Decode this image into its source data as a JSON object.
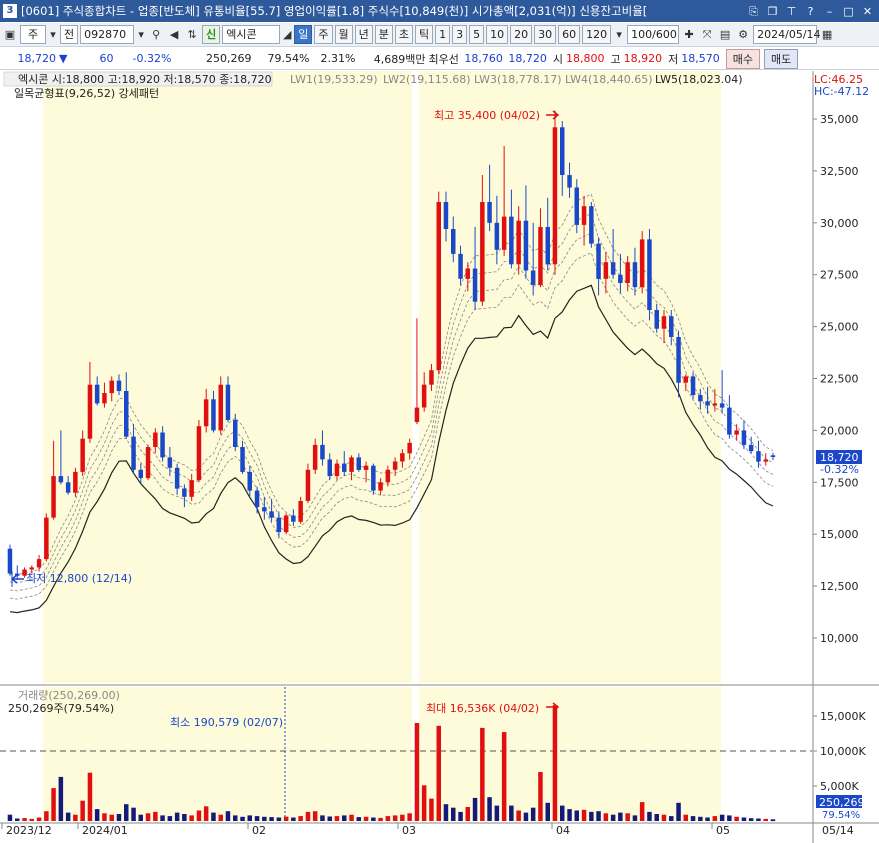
{
  "titlebar": {
    "screen_no": "3",
    "title": "[0601] 주식종합차트 - 업종[반도체] 유통비율[55.7] 영업이익률[1.8] 주식수[10,849(천)] 시가총액[2,031(억)] 신용잔고비율["
  },
  "toolbar": {
    "market": "주",
    "all_label": "전",
    "code": "092870",
    "credit_badge": "신",
    "stock_name": "엑시콘",
    "periods": [
      "일",
      "주",
      "월",
      "년",
      "분",
      "초",
      "틱"
    ],
    "intervals": [
      "1",
      "3",
      "5",
      "10",
      "20",
      "30",
      "60",
      "120"
    ],
    "count": "100/600",
    "date": "2024/05/14"
  },
  "quote": {
    "price": "18,720",
    "change": "60",
    "change_pct": "-0.32%",
    "volume": "250,269",
    "vol_ratio": "79.54%",
    "turnover": "2.31%",
    "amount": "4,689백만",
    "best_ask_label": "최우선",
    "best_ask": "18,760",
    "best_bid": "18,720",
    "open_label": "시",
    "open": "18,800",
    "high_label": "고",
    "high": "18,920",
    "low_label": "저",
    "low": "18,570",
    "buy_label": "매수",
    "sell_label": "매도"
  },
  "price_panel": {
    "legend_main": "엑시콘 시:18,800 고:18,920 저:18,570 종:18,720",
    "lw": [
      "LW1(19,533.29)",
      "LW2(19,115.68)",
      "LW3(18,778.17)",
      "LW4(18,440.65)",
      "LW5(18,023.04)"
    ],
    "sub_legend": "일목균형표(9,26,52) 강세패턴",
    "lc": "LC:46.25",
    "hc": "HC:-47.12",
    "max_label": "최고 35,400 (04/02)",
    "min_label": "최저 12,800 (12/14)",
    "price_tag": "18,720",
    "pct_tag": "-0.32%",
    "y_ticks": [
      "35,000",
      "32,500",
      "30,000",
      "27,500",
      "25,000",
      "22,500",
      "20,000",
      "17,500",
      "15,000",
      "12,500",
      "10,000"
    ]
  },
  "volume_panel": {
    "title": "거래량(250,269.00)",
    "sub": "250,269주(79.54%)",
    "min_label": "최소 190,579 (02/07)",
    "max_label": "최대 16,536K (04/02)",
    "y_ticks": [
      "15,000K",
      "10,000K",
      "5,000K"
    ],
    "vol_tag": "250,269",
    "pct_tag": "79.54%"
  },
  "x_axis": {
    "labels": [
      "2023/12",
      "2024/01",
      "02",
      "03",
      "04",
      "05"
    ],
    "right_label": "05/14"
  },
  "colors": {
    "up": "#e01010",
    "down": "#1a48c8",
    "highlight": "#fdfbd9",
    "titlebar": "#2e5a9c"
  },
  "candles": [
    [
      14300,
      14500,
      13000,
      13100
    ],
    [
      13100,
      13500,
      12800,
      13000
    ],
    [
      13000,
      13400,
      12900,
      13300
    ],
    [
      13300,
      13500,
      13100,
      13400
    ],
    [
      13400,
      14000,
      13200,
      13800
    ],
    [
      13800,
      16000,
      13700,
      15800
    ],
    [
      15800,
      19500,
      15700,
      17800
    ],
    [
      17800,
      20000,
      17400,
      17500
    ],
    [
      17500,
      17800,
      16900,
      17000
    ],
    [
      17000,
      18200,
      16800,
      18000
    ],
    [
      18000,
      20000,
      17800,
      19600
    ],
    [
      19600,
      23300,
      19400,
      22200
    ],
    [
      22200,
      22600,
      21200,
      21300
    ],
    [
      21300,
      22300,
      21100,
      21800
    ],
    [
      21800,
      22600,
      21400,
      22400
    ],
    [
      22400,
      22700,
      21700,
      21900
    ],
    [
      21900,
      22800,
      19600,
      19700
    ],
    [
      19700,
      20300,
      17900,
      18100
    ],
    [
      18100,
      18400,
      17400,
      17700
    ],
    [
      17700,
      19300,
      17600,
      19200
    ],
    [
      19200,
      20100,
      18900,
      19900
    ],
    [
      19900,
      20200,
      18500,
      18700
    ],
    [
      18700,
      19200,
      17800,
      18200
    ],
    [
      18200,
      18400,
      16900,
      17200
    ],
    [
      17200,
      17400,
      16300,
      16800
    ],
    [
      16800,
      17900,
      16600,
      17600
    ],
    [
      17600,
      20500,
      17500,
      20200
    ],
    [
      20200,
      22000,
      19900,
      21500
    ],
    [
      21500,
      21900,
      19900,
      20000
    ],
    [
      20000,
      22600,
      19800,
      22200
    ],
    [
      22200,
      22600,
      20400,
      20500
    ],
    [
      20500,
      20800,
      19000,
      19200
    ],
    [
      19200,
      19500,
      17900,
      18000
    ],
    [
      18000,
      18300,
      16800,
      17100
    ],
    [
      17100,
      17300,
      16000,
      16300
    ],
    [
      16300,
      16800,
      15700,
      16100
    ],
    [
      16100,
      16700,
      15600,
      15800
    ],
    [
      15800,
      16100,
      14800,
      15100
    ],
    [
      15100,
      16000,
      15000,
      15900
    ],
    [
      15900,
      16200,
      15400,
      15600
    ],
    [
      15600,
      16800,
      15500,
      16600
    ],
    [
      16600,
      18400,
      16500,
      18100
    ],
    [
      18100,
      19600,
      17900,
      19300
    ],
    [
      19300,
      20000,
      18300,
      18600
    ],
    [
      18600,
      18900,
      17600,
      17800
    ],
    [
      17800,
      18600,
      17600,
      18400
    ],
    [
      18400,
      19000,
      17800,
      18000
    ],
    [
      18000,
      18800,
      17600,
      18700
    ],
    [
      18700,
      18900,
      18000,
      18100
    ],
    [
      18100,
      18500,
      17500,
      18300
    ],
    [
      18300,
      18400,
      16900,
      17100
    ],
    [
      17100,
      17700,
      16900,
      17500
    ],
    [
      17500,
      18300,
      17300,
      18100
    ],
    [
      18100,
      18700,
      17800,
      18500
    ],
    [
      18500,
      19100,
      18200,
      18900
    ],
    [
      18900,
      19600,
      18600,
      19400
    ],
    [
      20400,
      25400,
      20300,
      21100
    ],
    [
      21100,
      22800,
      20900,
      22200
    ],
    [
      22200,
      23200,
      21900,
      22900
    ],
    [
      22900,
      31500,
      22700,
      31000
    ],
    [
      31000,
      31500,
      29100,
      29700
    ],
    [
      29700,
      30300,
      28100,
      28500
    ],
    [
      28500,
      28900,
      27000,
      27300
    ],
    [
      27300,
      28100,
      26700,
      27800
    ],
    [
      27800,
      29800,
      25800,
      26200
    ],
    [
      26200,
      32300,
      26000,
      31000
    ],
    [
      31000,
      32800,
      29600,
      30000
    ],
    [
      30000,
      31300,
      28000,
      28700
    ],
    [
      28700,
      33700,
      28400,
      30300
    ],
    [
      30300,
      31600,
      27800,
      28000
    ],
    [
      28000,
      30800,
      27500,
      30100
    ],
    [
      30100,
      31800,
      27300,
      27700
    ],
    [
      27700,
      30000,
      26500,
      27000
    ],
    [
      27000,
      30700,
      26900,
      29800
    ],
    [
      29800,
      31200,
      27700,
      28000
    ],
    [
      28000,
      35400,
      27500,
      34600
    ],
    [
      34600,
      34900,
      31300,
      32300
    ],
    [
      32300,
      32900,
      31200,
      31700
    ],
    [
      31700,
      32100,
      29500,
      29900
    ],
    [
      29900,
      31300,
      28900,
      30800
    ],
    [
      30800,
      31000,
      28800,
      29000
    ],
    [
      29000,
      29300,
      26500,
      27300
    ],
    [
      27300,
      28600,
      26600,
      28100
    ],
    [
      28100,
      29700,
      27300,
      27500
    ],
    [
      27500,
      28500,
      26600,
      27100
    ],
    [
      27100,
      28400,
      26700,
      28100
    ],
    [
      28100,
      28800,
      26500,
      26900
    ],
    [
      26900,
      29600,
      26600,
      29200
    ],
    [
      29200,
      29700,
      25300,
      25800
    ],
    [
      25800,
      26100,
      24700,
      24900
    ],
    [
      24900,
      25800,
      24200,
      25500
    ],
    [
      25500,
      25800,
      24100,
      24500
    ],
    [
      24500,
      24800,
      21600,
      22300
    ],
    [
      22300,
      22700,
      21900,
      22600
    ],
    [
      22600,
      22800,
      21500,
      21700
    ],
    [
      21700,
      22000,
      21000,
      21400
    ],
    [
      21400,
      22100,
      20800,
      21200
    ],
    [
      21200,
      22000,
      20900,
      21300
    ],
    [
      21300,
      22900,
      20800,
      21100
    ],
    [
      21100,
      21700,
      19600,
      19800
    ],
    [
      19800,
      20300,
      19500,
      20000
    ],
    [
      20000,
      20500,
      19100,
      19300
    ],
    [
      19300,
      19700,
      18900,
      19000
    ],
    [
      19000,
      19500,
      18200,
      18500
    ],
    [
      18500,
      18900,
      18300,
      18600
    ],
    [
      18800,
      18920,
      18570,
      18720
    ]
  ],
  "volumes": [
    900,
    350,
    420,
    300,
    500,
    1400,
    4700,
    6300,
    1200,
    900,
    2900,
    6900,
    1700,
    1100,
    900,
    1000,
    2400,
    1900,
    900,
    1100,
    1300,
    800,
    700,
    1200,
    1000,
    800,
    1500,
    2100,
    1200,
    900,
    1400,
    800,
    600,
    800,
    700,
    600,
    550,
    500,
    620,
    500,
    700,
    1300,
    1400,
    800,
    650,
    700,
    800,
    900,
    550,
    600,
    500,
    450,
    700,
    800,
    900,
    1100,
    14000,
    5100,
    3200,
    13600,
    2400,
    1900,
    1300,
    2000,
    3300,
    13300,
    3400,
    2200,
    12700,
    2200,
    1500,
    1200,
    1900,
    7000,
    2600,
    16536,
    2200,
    1700,
    1500,
    1600,
    1300,
    1400,
    1100,
    900,
    1200,
    1100,
    800,
    2700,
    1300,
    1000,
    900,
    700,
    2600,
    900,
    700,
    600,
    500,
    700,
    900,
    800,
    600,
    500,
    400,
    350,
    300,
    250
  ]
}
